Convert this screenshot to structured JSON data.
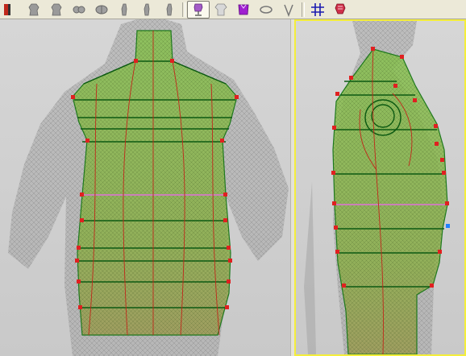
{
  "toolbar": {
    "tools": [
      {
        "name": "partial-icon",
        "icon": "edge"
      },
      {
        "name": "mannequin-back-icon",
        "icon": "torso-gray"
      },
      {
        "name": "mannequin-front-icon",
        "icon": "torso-gray"
      },
      {
        "name": "mannequin-bust-icon",
        "icon": "bust-gray"
      },
      {
        "name": "mannequin-hips-icon",
        "icon": "hips-gray"
      },
      {
        "name": "mannequin-side-left-icon",
        "icon": "side-gray"
      },
      {
        "name": "mannequin-side-right-icon",
        "icon": "side-gray"
      },
      {
        "name": "mannequin-stand-icon",
        "icon": "side-gray"
      },
      {
        "name": "dress-form-icon",
        "icon": "form-purple",
        "active": true
      },
      {
        "name": "torso-icon",
        "icon": "torso-light"
      },
      {
        "name": "bodice-icon",
        "icon": "bodice-purple"
      },
      {
        "name": "neck-ring-icon",
        "icon": "ring"
      },
      {
        "name": "collar-icon",
        "icon": "collar"
      },
      {
        "name": "grid-lines-icon",
        "icon": "grid"
      },
      {
        "name": "dress-form-red-icon",
        "icon": "form-red"
      }
    ]
  },
  "colors": {
    "shape_fill": "#7fb848",
    "shape_stroke": "#1d7a1d",
    "line_dark": "#0c5a12",
    "line_magenta": "#e070d8",
    "seam_red": "#c0281a",
    "handle_red": "#e02020",
    "handle_blue": "#2080ff",
    "scan_gray": "#8c8c8c",
    "active_border": "#f4ee3a"
  }
}
